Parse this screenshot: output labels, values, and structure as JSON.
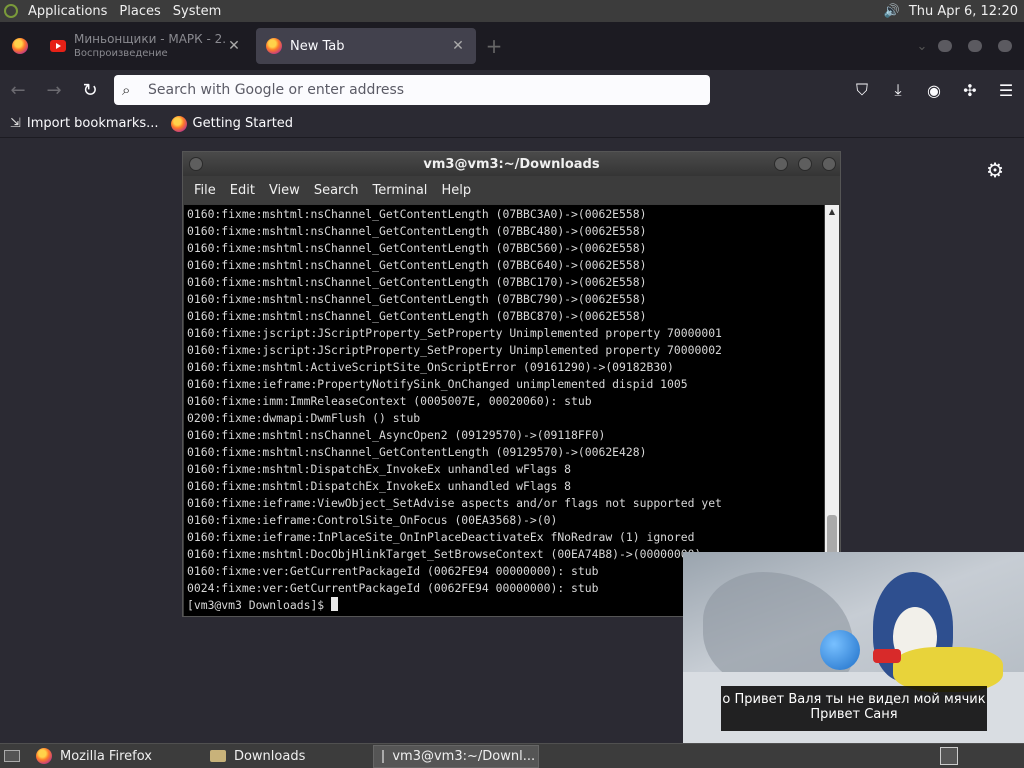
{
  "top_panel": {
    "menus": [
      "Applications",
      "Places",
      "System"
    ],
    "clock": "Thu Apr  6, 12:20"
  },
  "browser": {
    "tabs": [
      {
        "title": "Миньонщики - МАРК - 2...",
        "subtitle": "Воспроизведение",
        "icon": "youtube-icon",
        "active": false
      },
      {
        "title": "New Tab",
        "icon": "firefox-icon",
        "active": true
      }
    ],
    "url_placeholder": "Search with Google or enter address",
    "bookmarks": [
      {
        "label": "Import bookmarks...",
        "icon": "import-icon"
      },
      {
        "label": "Getting Started",
        "icon": "firefox-icon"
      }
    ]
  },
  "terminal": {
    "title": "vm3@vm3:~/Downloads",
    "menu": [
      "File",
      "Edit",
      "View",
      "Search",
      "Terminal",
      "Help"
    ],
    "lines": [
      "0160:fixme:mshtml:nsChannel_GetContentLength (07BBC3A0)->(0062E558)",
      "0160:fixme:mshtml:nsChannel_GetContentLength (07BBC480)->(0062E558)",
      "0160:fixme:mshtml:nsChannel_GetContentLength (07BBC560)->(0062E558)",
      "0160:fixme:mshtml:nsChannel_GetContentLength (07BBC640)->(0062E558)",
      "0160:fixme:mshtml:nsChannel_GetContentLength (07BBC170)->(0062E558)",
      "0160:fixme:mshtml:nsChannel_GetContentLength (07BBC790)->(0062E558)",
      "0160:fixme:mshtml:nsChannel_GetContentLength (07BBC870)->(0062E558)",
      "0160:fixme:jscript:JScriptProperty_SetProperty Unimplemented property 70000001",
      "0160:fixme:jscript:JScriptProperty_SetProperty Unimplemented property 70000002",
      "0160:fixme:mshtml:ActiveScriptSite_OnScriptError (09161290)->(09182B30)",
      "0160:fixme:ieframe:PropertyNotifySink_OnChanged unimplemented dispid 1005",
      "0160:fixme:imm:ImmReleaseContext (0005007E, 00020060): stub",
      "0200:fixme:dwmapi:DwmFlush () stub",
      "0160:fixme:mshtml:nsChannel_AsyncOpen2 (09129570)->(09118FF0)",
      "0160:fixme:mshtml:nsChannel_GetContentLength (09129570)->(0062E428)",
      "0160:fixme:mshtml:DispatchEx_InvokeEx unhandled wFlags 8",
      "0160:fixme:mshtml:DispatchEx_InvokeEx unhandled wFlags 8",
      "0160:fixme:ieframe:ViewObject_SetAdvise aspects and/or flags not supported yet",
      "0160:fixme:ieframe:ControlSite_OnFocus (00EA3568)->(0)",
      "0160:fixme:ieframe:InPlaceSite_OnInPlaceDeactivateEx fNoRedraw (1) ignored",
      "0160:fixme:mshtml:DocObjHlinkTarget_SetBrowseContext (00EA74B8)->(00000000)",
      "0160:fixme:ver:GetCurrentPackageId (0062FE94 00000000): stub",
      "0024:fixme:ver:GetCurrentPackageId (0062FE94 00000000): stub"
    ],
    "prompt": "[vm3@vm3 Downloads]$ "
  },
  "video": {
    "subtitle_line1": "о Привет Валя ты не видел мой мячик",
    "subtitle_line2": "Привет Саня"
  },
  "taskbar": {
    "tasks": [
      {
        "label": "Mozilla Firefox",
        "icon": "firefox-icon",
        "active": false
      },
      {
        "label": "Downloads",
        "icon": "folder-icon",
        "active": false
      },
      {
        "label": "vm3@vm3:~/Downl...",
        "icon": "terminal-icon",
        "active": true
      }
    ]
  }
}
